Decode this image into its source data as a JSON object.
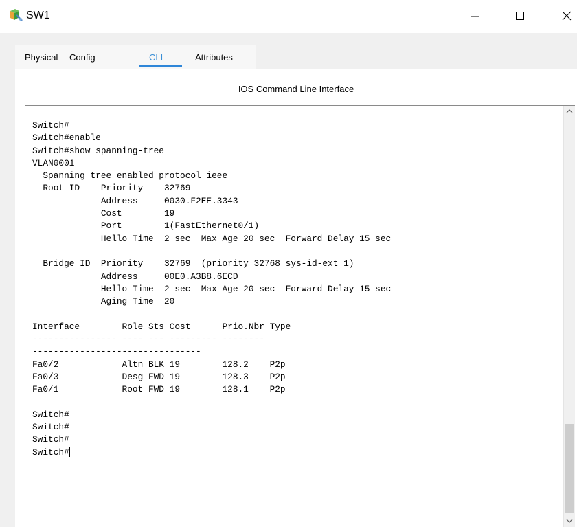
{
  "window": {
    "title": "SW1",
    "app_icon": "packet-tracer-switch-icon",
    "controls": {
      "minimize_icon": "minimize-icon",
      "maximize_icon": "maximize-icon",
      "close_icon": "close-icon"
    }
  },
  "tabs": [
    {
      "label": "Physical",
      "active": false
    },
    {
      "label": "Config",
      "active": false
    },
    {
      "label": "CLI",
      "active": true
    },
    {
      "label": "Attributes",
      "active": false
    }
  ],
  "section": {
    "header": "IOS Command Line Interface"
  },
  "terminal": {
    "lines": [
      "Switch#",
      "Switch#enable",
      "Switch#show spanning-tree",
      "VLAN0001",
      "  Spanning tree enabled protocol ieee",
      "  Root ID    Priority    32769",
      "             Address     0030.F2EE.3343",
      "             Cost        19",
      "             Port        1(FastEthernet0/1)",
      "             Hello Time  2 sec  Max Age 20 sec  Forward Delay 15 sec",
      "",
      "  Bridge ID  Priority    32769  (priority 32768 sys-id-ext 1)",
      "             Address     00E0.A3B8.6ECD",
      "             Hello Time  2 sec  Max Age 20 sec  Forward Delay 15 sec",
      "             Aging Time  20",
      "",
      "Interface        Role Sts Cost      Prio.Nbr Type",
      "---------------- ---- --- --------- --------",
      "--------------------------------",
      "Fa0/2            Altn BLK 19        128.2    P2p",
      "Fa0/3            Desg FWD 19        128.3    P2p",
      "Fa0/1            Root FWD 19        128.1    P2p",
      "",
      "Switch#",
      "Switch#",
      "Switch#"
    ],
    "prompt": "Switch#"
  },
  "colors": {
    "accent": "#2f86d8",
    "tab_strip_bg": "#f0f0f0",
    "terminal_text": "#000000"
  }
}
